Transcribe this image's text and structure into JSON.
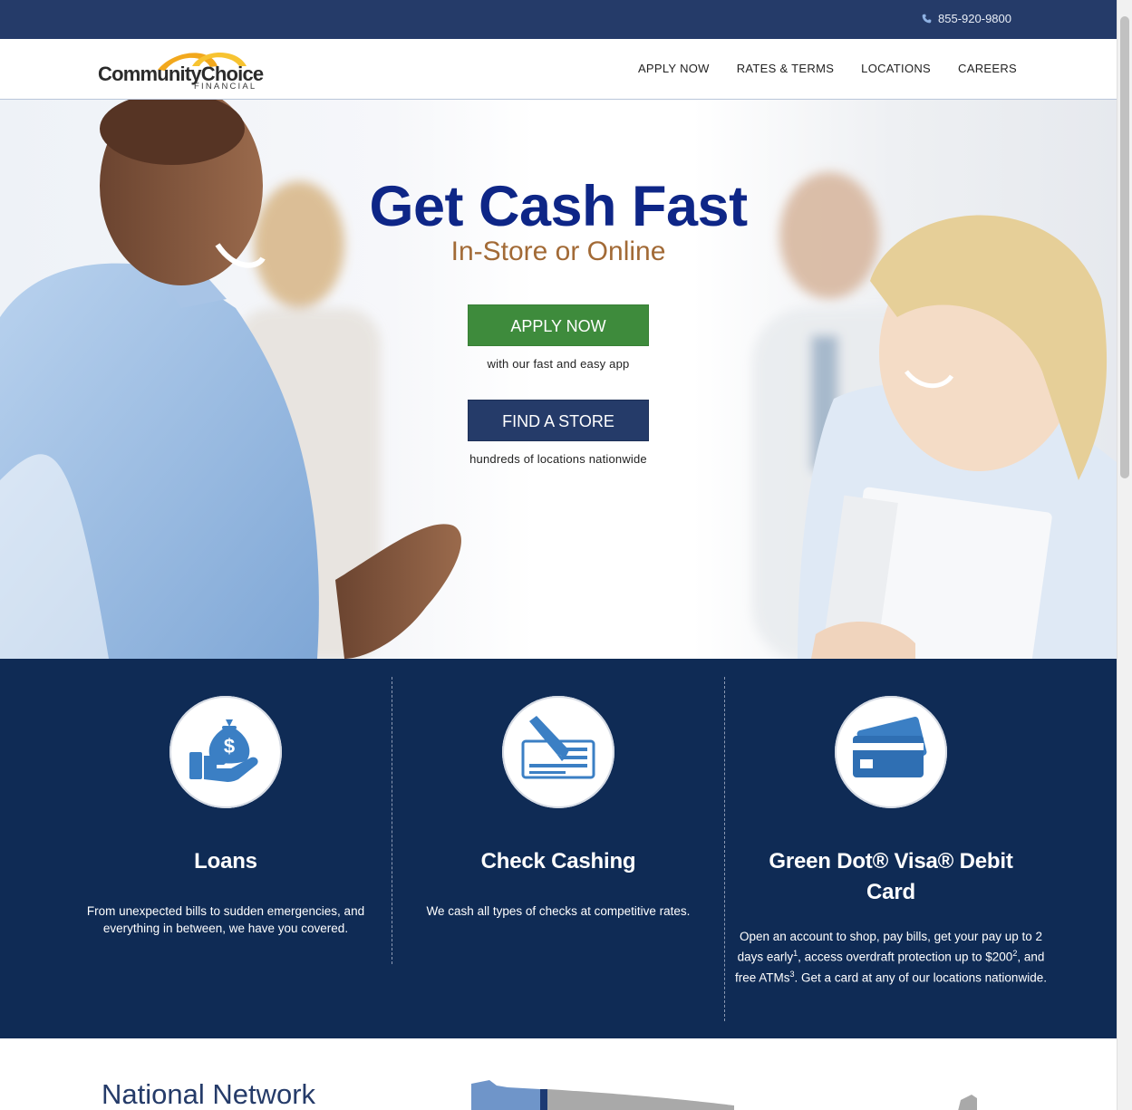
{
  "topbar": {
    "phone": "855-920-9800",
    "phone_icon": "phone-icon"
  },
  "brand": {
    "name": "CommunityChoice",
    "sub": "FINANCIAL"
  },
  "nav": {
    "items": [
      {
        "label": "APPLY NOW"
      },
      {
        "label": "RATES & TERMS"
      },
      {
        "label": "LOCATIONS"
      },
      {
        "label": "CAREERS"
      }
    ]
  },
  "hero": {
    "title": "Get Cash Fast",
    "subtitle": "In-Store or Online",
    "apply_label": "APPLY NOW",
    "apply_caption": "with our fast and easy app",
    "find_label": "FIND A STORE",
    "find_caption": "hundreds of locations nationwide"
  },
  "services": [
    {
      "icon": "money-bag-hand-icon",
      "title": "Loans",
      "text": "From unexpected bills to sudden emergencies, and everything in between, we have you covered."
    },
    {
      "icon": "check-pen-icon",
      "title": "Check Cashing",
      "text": "We cash all types of checks at competitive rates."
    },
    {
      "icon": "debit-card-icon",
      "title": "Green Dot® Visa® Debit Card",
      "text_parts": [
        "Open an account to shop, pay bills, get your pay up to 2 days early",
        "1",
        ", access overdraft protection up to $200",
        "2",
        ", and free ATMs",
        "3",
        ". Get a card at any of our locations nationwide."
      ]
    }
  ],
  "network": {
    "title": "National Network"
  },
  "colors": {
    "topbar": "#253b69",
    "title_blue": "#0e2687",
    "subtitle_brown": "#a26a36",
    "apply_green": "#3e8b3c",
    "services_bg": "#0f2b55",
    "icon_blue": "#3b7fc4"
  }
}
